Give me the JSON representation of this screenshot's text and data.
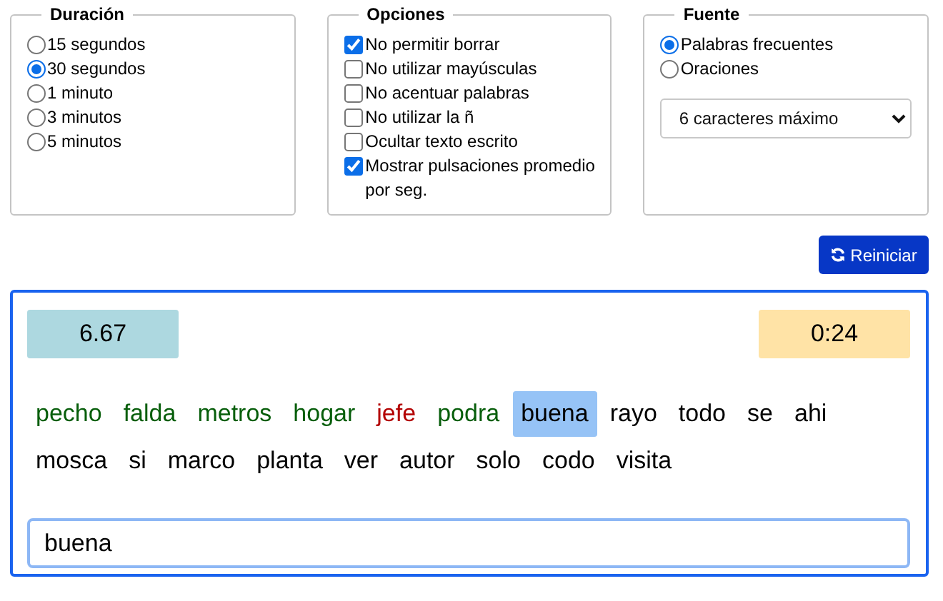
{
  "duration": {
    "title": "Duración",
    "options": [
      {
        "label": "15 segundos",
        "selected": false
      },
      {
        "label": "30 segundos",
        "selected": true
      },
      {
        "label": "1 minuto",
        "selected": false
      },
      {
        "label": "3 minutos",
        "selected": false
      },
      {
        "label": "5 minutos",
        "selected": false
      }
    ]
  },
  "options": {
    "title": "Opciones",
    "items": [
      {
        "label": "No permitir borrar",
        "checked": true
      },
      {
        "label": "No utilizar mayúsculas",
        "checked": false
      },
      {
        "label": "No acentuar palabras",
        "checked": false
      },
      {
        "label": "No utilizar la ñ",
        "checked": false
      },
      {
        "label": "Ocultar texto escrito",
        "checked": false
      },
      {
        "label": "Mostrar pulsaciones promedio por seg.",
        "checked": true
      }
    ]
  },
  "source": {
    "title": "Fuente",
    "options": [
      {
        "label": "Palabras frecuentes",
        "selected": true
      },
      {
        "label": "Oraciones",
        "selected": false
      }
    ],
    "length_select": "6 caracteres máximo"
  },
  "restart_button": "Reiniciar",
  "stats": {
    "speed": "6.67",
    "time": "0:24"
  },
  "words": [
    {
      "text": "pecho",
      "kind": "correct"
    },
    {
      "text": "falda",
      "kind": "correct"
    },
    {
      "text": "metros",
      "kind": "correct"
    },
    {
      "text": "hogar",
      "kind": "correct"
    },
    {
      "text": "jefe",
      "kind": "wrong"
    },
    {
      "text": "podra",
      "kind": "correct"
    },
    {
      "text": "buena",
      "kind": "current"
    },
    {
      "text": "rayo",
      "kind": "pending"
    },
    {
      "text": "todo",
      "kind": "pending"
    },
    {
      "text": "se",
      "kind": "pending"
    },
    {
      "text": "ahi",
      "kind": "pending"
    },
    {
      "text": "mosca",
      "kind": "pending"
    },
    {
      "text": "si",
      "kind": "pending"
    },
    {
      "text": "marco",
      "kind": "pending"
    },
    {
      "text": "planta",
      "kind": "pending"
    },
    {
      "text": "ver",
      "kind": "pending"
    },
    {
      "text": "autor",
      "kind": "pending"
    },
    {
      "text": "solo",
      "kind": "pending"
    },
    {
      "text": "codo",
      "kind": "pending"
    },
    {
      "text": "visita",
      "kind": "pending"
    }
  ],
  "typing_field": "buena"
}
